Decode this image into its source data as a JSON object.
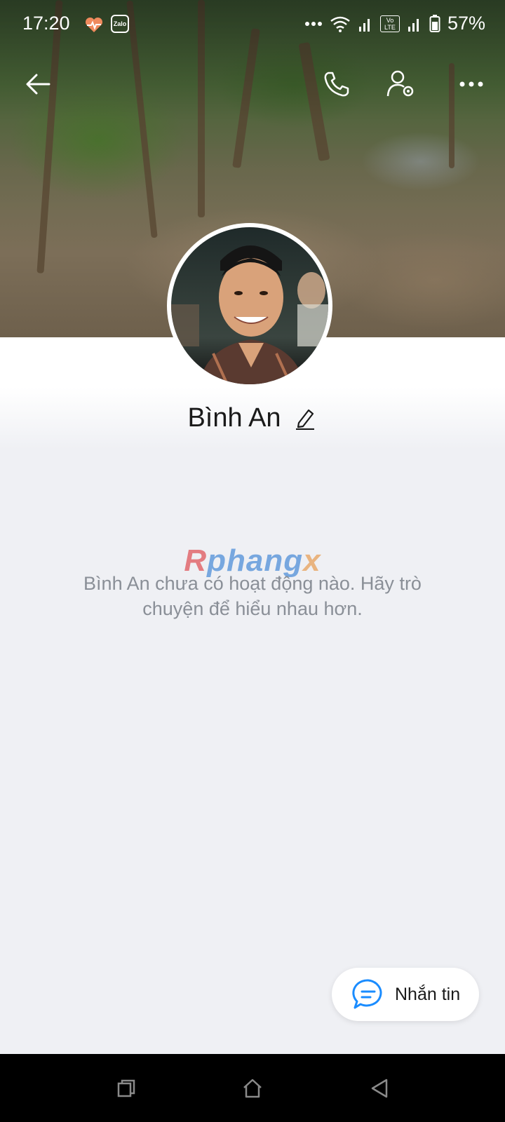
{
  "status_bar": {
    "time": "17:20",
    "zalo_badge": "Zalo",
    "network_badge": "Vo LTE",
    "battery": "57%"
  },
  "header": {
    "back_icon": "arrow-left-icon",
    "call_icon": "phone-icon",
    "settings_icon": "user-settings-icon",
    "more_icon": "more-horizontal-icon"
  },
  "profile": {
    "name": "Bình An",
    "edit_icon": "pencil-icon"
  },
  "watermark": {
    "part1": "R",
    "part2": "phang",
    "part3": "x"
  },
  "empty_state": {
    "message": "Bình An chưa có hoạt động nào. Hãy trò chuyện để hiểu nhau hơn."
  },
  "message_button": {
    "label": "Nhắn tin",
    "icon": "chat-bubble-icon",
    "accent": "#1a8cff"
  },
  "nav": {
    "recents_icon": "recents-icon",
    "home_icon": "home-icon",
    "back_icon": "triangle-back-icon"
  }
}
